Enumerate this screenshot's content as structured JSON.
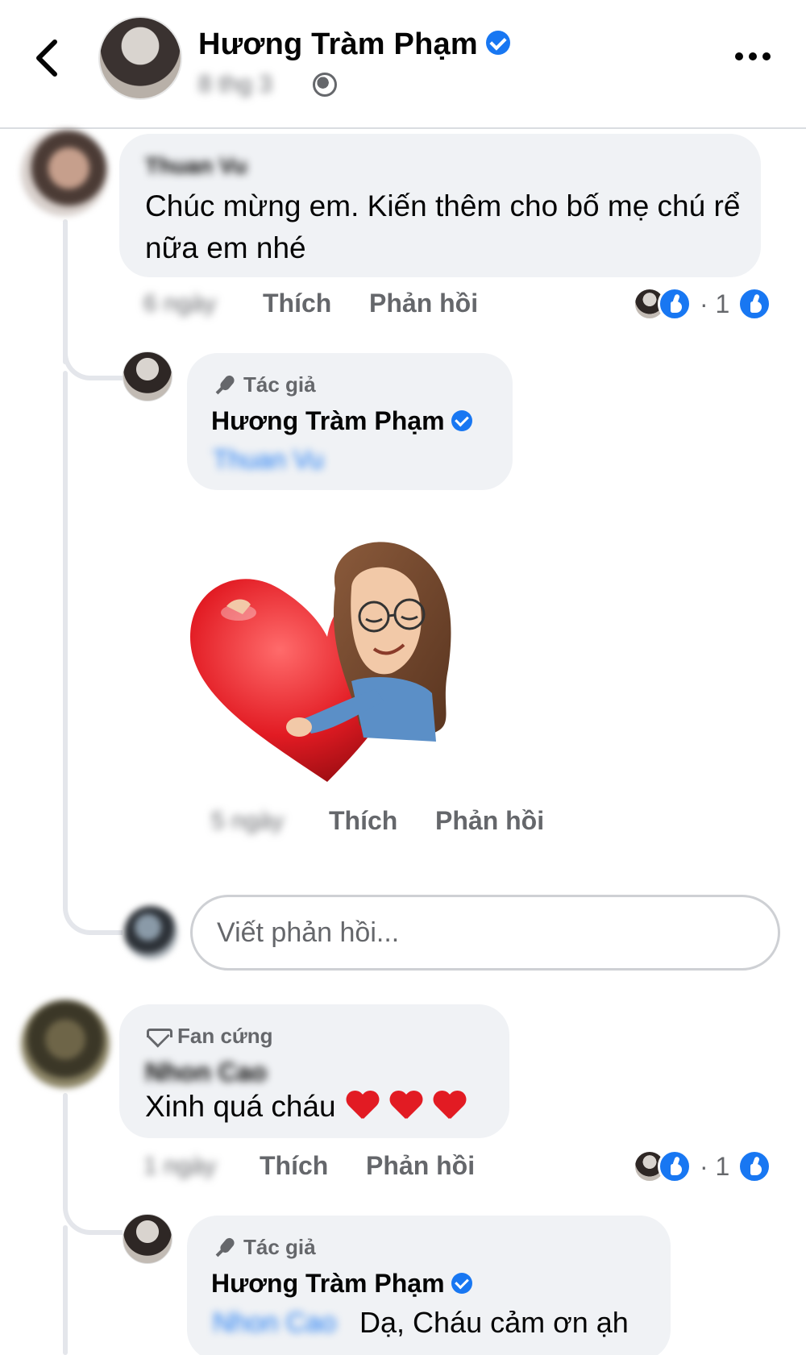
{
  "header": {
    "author_name": "Hương Tràm Phạm",
    "timestamp": "8 thg 3",
    "back_icon": "chevron-left-icon",
    "more_icon": "more-icon",
    "privacy_icon": "globe-icon"
  },
  "comments": [
    {
      "author": "Thuan Vu",
      "text": "Chúc mừng em. Kiến thêm cho bố mẹ chú rể nữa em nhé",
      "time": "6 ngày",
      "like_label": "Thích",
      "reply_label": "Phản hồi",
      "reaction_count": "1",
      "replies": [
        {
          "badge": "Tác giả",
          "author": "Hương Tràm Phạm",
          "mention": "Thuan Vu",
          "sticker": "heart-hug-sticker",
          "time": "5 ngày",
          "like_label": "Thích",
          "reply_label": "Phản hồi"
        }
      ]
    },
    {
      "badge": "Fan cứng",
      "author": "Nhon Cao",
      "text": "Xinh quá cháu",
      "time": "1 ngày",
      "like_label": "Thích",
      "reply_label": "Phản hồi",
      "reaction_count": "1",
      "replies": [
        {
          "badge": "Tác giả",
          "author": "Hương Tràm Phạm",
          "mention": "Nhon Cao",
          "text": "Dạ, Cháu cảm ơn ạh"
        }
      ]
    }
  ],
  "reply_input": {
    "placeholder": "Viết phản hồi..."
  },
  "colors": {
    "accent": "#1877f2",
    "bubble": "#f0f2f5",
    "secondary_text": "#65676b",
    "heart": "#e21b23"
  }
}
